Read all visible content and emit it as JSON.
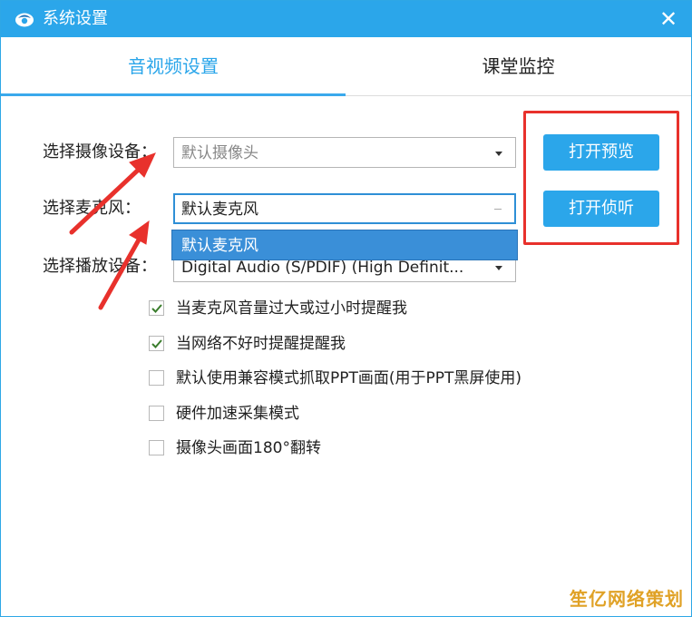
{
  "window": {
    "title": "系统设置",
    "close_glyph": "✕",
    "colors": {
      "accent": "#2ba6ea",
      "annotation": "#e8312c"
    }
  },
  "tabs": [
    {
      "label": "音视频设置",
      "active": true
    },
    {
      "label": "课堂监控",
      "active": false
    }
  ],
  "fields": {
    "camera": {
      "label": "选择摄像设备：",
      "value": "默认摄像头"
    },
    "microphone": {
      "label": "选择麦克风：",
      "value": "默认麦克风"
    },
    "playback": {
      "label": "选择播放设备：",
      "value": "Digital Audio (S/PDIF) (High Definit..."
    }
  },
  "microphone_dropdown": {
    "options": [
      "默认麦克风"
    ]
  },
  "buttons": {
    "open_preview": "打开预览",
    "open_listen": "打开侦听"
  },
  "checkboxes": [
    {
      "label": "当麦克风音量过大或过小时提醒我",
      "checked": true
    },
    {
      "label": "当网络不好时提醒提醒我",
      "checked": true
    },
    {
      "label": "默认使用兼容模式抓取PPT画面(用于PPT黑屏使用)",
      "checked": false
    },
    {
      "label": "硬件加速采集模式",
      "checked": false
    },
    {
      "label": "摄像头画面180°翻转",
      "checked": false
    }
  ],
  "icons": {
    "app": "app-logo-icon",
    "close": "close-icon",
    "dropdown": "chevron-down-icon",
    "check": "check-icon"
  },
  "watermark": "笙亿网络策划"
}
